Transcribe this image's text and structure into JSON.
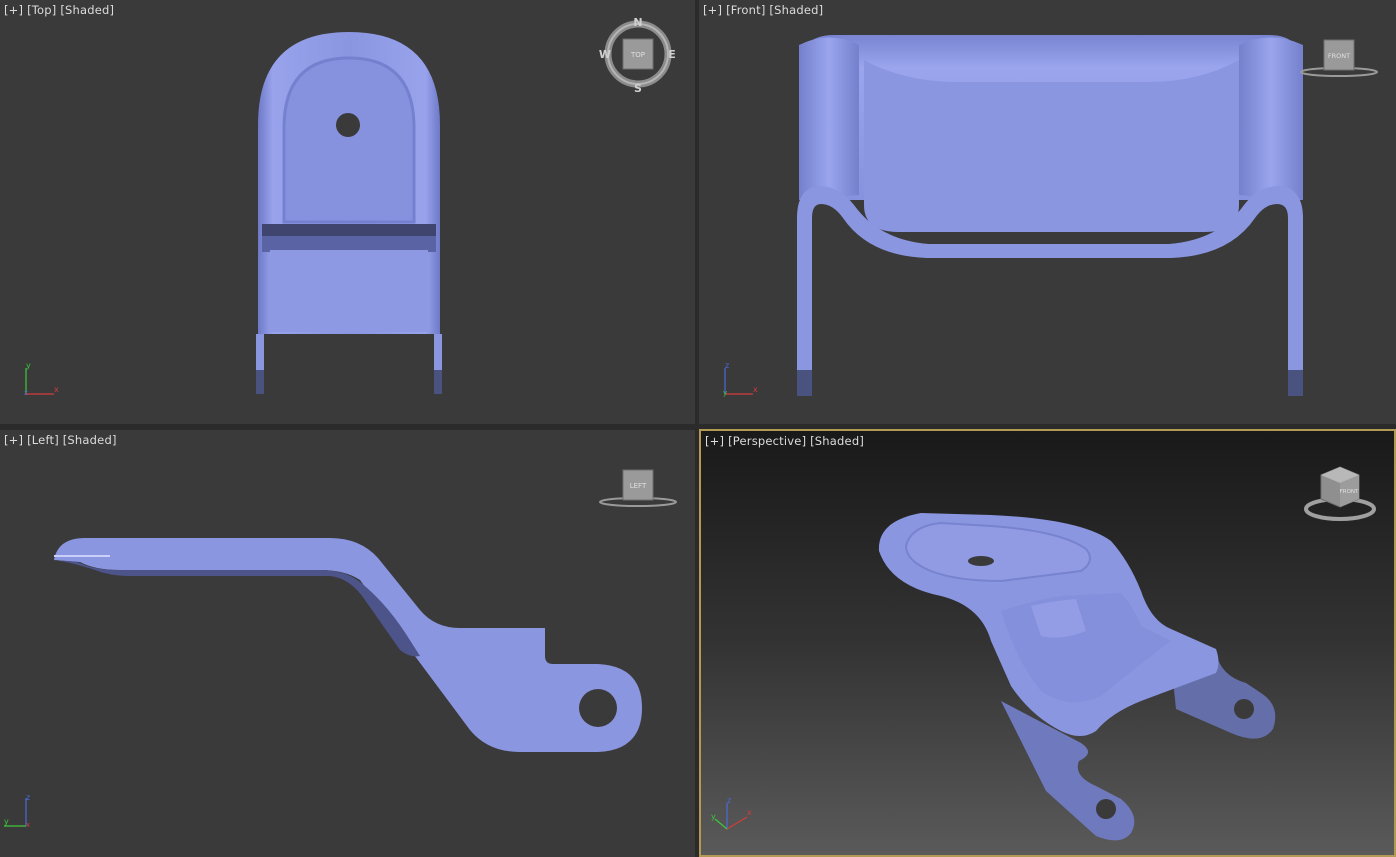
{
  "viewports": {
    "top": {
      "plus": "[+]",
      "view": "[Top]",
      "mode": "[Shaded]",
      "cube_label": "TOP",
      "compass": {
        "n": "N",
        "s": "S",
        "e": "E",
        "w": "W"
      },
      "axes": {
        "a": "y",
        "b": "x",
        "c": "z"
      }
    },
    "front": {
      "plus": "[+]",
      "view": "[Front]",
      "mode": "[Shaded]",
      "cube_label": "FRONT",
      "axes": {
        "a": "z",
        "b": "x",
        "c": "y"
      }
    },
    "left": {
      "plus": "[+]",
      "view": "[Left]",
      "mode": "[Shaded]",
      "cube_label": "LEFT",
      "axes": {
        "a": "z",
        "b": "y",
        "c": "x"
      }
    },
    "persp": {
      "plus": "[+]",
      "view": "[Perspective]",
      "mode": "[Shaded]",
      "cube_label": "FRONT",
      "axes": {
        "a": "z",
        "b": "x",
        "c": "y"
      }
    }
  },
  "colors": {
    "model": "#8a96e0",
    "model_dark": "#5f6ab0",
    "viewport_bg": "#3a3a3a",
    "active_border": "#b29a55",
    "axis_x": "#d23c3c",
    "axis_y": "#3cc83c",
    "axis_z": "#4a6ad8"
  }
}
